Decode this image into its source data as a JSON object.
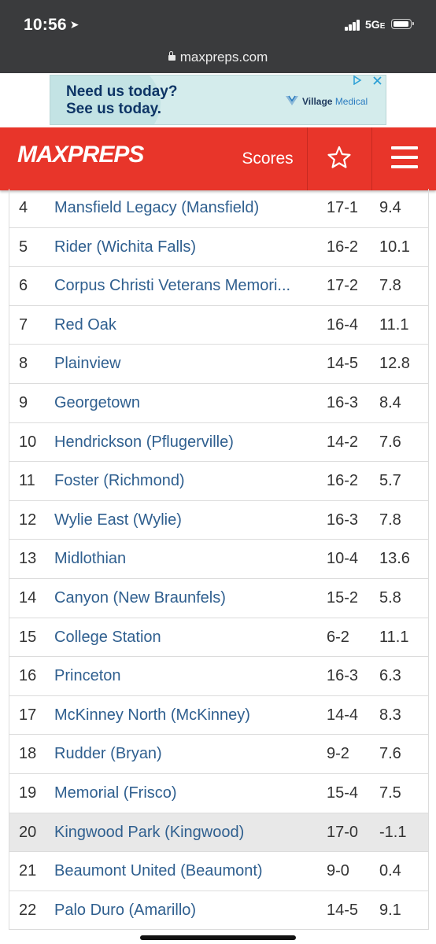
{
  "status_bar": {
    "time": "10:56",
    "network": "5G",
    "network_suffix": "E"
  },
  "browser": {
    "url": "maxpreps.com"
  },
  "ad": {
    "headline_line1": "Need us today?",
    "headline_line2": "See us today.",
    "brand_name": "Village",
    "brand_suffix": "Medical"
  },
  "header": {
    "logo_text": "MAXPREPS",
    "scores_label": "Scores"
  },
  "colors": {
    "brand_red": "#e8352a",
    "link_blue": "#2f5f8f",
    "status_bar": "#3a3b3d"
  },
  "rankings": [
    {
      "rank": "4",
      "school": "Mansfield Legacy (Mansfield)",
      "record": "17-1",
      "rating": "9.4"
    },
    {
      "rank": "5",
      "school": "Rider (Wichita Falls)",
      "record": "16-2",
      "rating": "10.1"
    },
    {
      "rank": "6",
      "school": "Corpus Christi Veterans Memori...",
      "record": "17-2",
      "rating": "7.8"
    },
    {
      "rank": "7",
      "school": "Red Oak",
      "record": "16-4",
      "rating": "11.1"
    },
    {
      "rank": "8",
      "school": "Plainview",
      "record": "14-5",
      "rating": "12.8"
    },
    {
      "rank": "9",
      "school": "Georgetown",
      "record": "16-3",
      "rating": "8.4"
    },
    {
      "rank": "10",
      "school": "Hendrickson (Pflugerville)",
      "record": "14-2",
      "rating": "7.6"
    },
    {
      "rank": "11",
      "school": "Foster (Richmond)",
      "record": "16-2",
      "rating": "5.7"
    },
    {
      "rank": "12",
      "school": "Wylie East (Wylie)",
      "record": "16-3",
      "rating": "7.8"
    },
    {
      "rank": "13",
      "school": "Midlothian",
      "record": "10-4",
      "rating": "13.6"
    },
    {
      "rank": "14",
      "school": "Canyon (New Braunfels)",
      "record": "15-2",
      "rating": "5.8"
    },
    {
      "rank": "15",
      "school": "College Station",
      "record": "6-2",
      "rating": "11.1"
    },
    {
      "rank": "16",
      "school": "Princeton",
      "record": "16-3",
      "rating": "6.3"
    },
    {
      "rank": "17",
      "school": "McKinney North (McKinney)",
      "record": "14-4",
      "rating": "8.3"
    },
    {
      "rank": "18",
      "school": "Rudder (Bryan)",
      "record": "9-2",
      "rating": "7.6"
    },
    {
      "rank": "19",
      "school": "Memorial (Frisco)",
      "record": "15-4",
      "rating": "7.5"
    },
    {
      "rank": "20",
      "school": "Kingwood Park (Kingwood)",
      "record": "17-0",
      "rating": "-1.1",
      "highlighted": true
    },
    {
      "rank": "21",
      "school": "Beaumont United (Beaumont)",
      "record": "9-0",
      "rating": "0.4"
    },
    {
      "rank": "22",
      "school": "Palo Duro (Amarillo)",
      "record": "14-5",
      "rating": "9.1"
    }
  ]
}
